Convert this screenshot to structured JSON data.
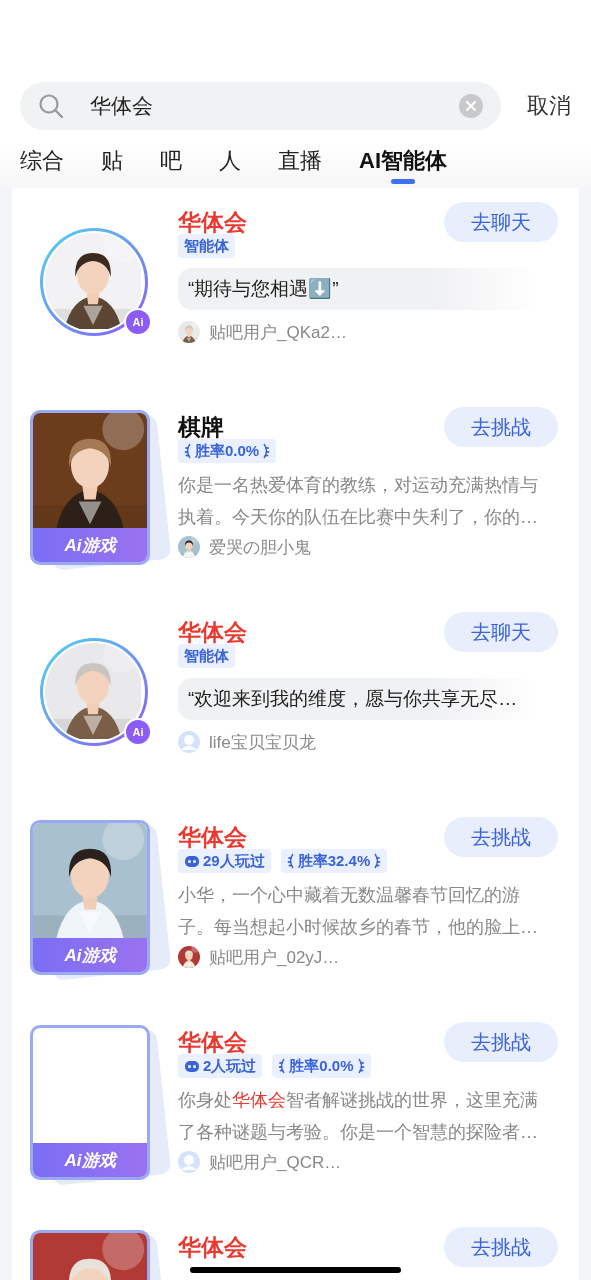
{
  "search": {
    "value": "华体会",
    "cancel": "取消"
  },
  "tabs": [
    {
      "label": "综合",
      "selected": false
    },
    {
      "label": "贴",
      "selected": false
    },
    {
      "label": "吧",
      "selected": false
    },
    {
      "label": "人",
      "selected": false
    },
    {
      "label": "直播",
      "selected": false
    },
    {
      "label": "AI智能体",
      "selected": true
    }
  ],
  "results": [
    {
      "kind": "agent",
      "title": "华体会",
      "highlighted": true,
      "button": "去聊天",
      "badge": "Ai",
      "tags": [
        {
          "kind": "type",
          "text": "智能体"
        }
      ],
      "quote": "“期待与您相遇⬇️”",
      "author": "贴吧用户_QKa2…",
      "author_avatar": {
        "kind": "picture"
      }
    },
    {
      "kind": "game",
      "title": "棋牌",
      "highlighted": false,
      "button": "去挑战",
      "banner": "Ai游戏",
      "picture": true,
      "tags": [
        {
          "kind": "winrate",
          "text": "胜率0.0%"
        }
      ],
      "description": [
        [
          {
            "text": "你是一名热爱体育的教练，对运动充满热情与",
            "highlighted": false
          }
        ],
        [
          {
            "text": "执着。今天你的队伍在比赛中失利了，你的…",
            "highlighted": false
          }
        ]
      ],
      "author": "爱哭の胆小鬼",
      "author_avatar": {
        "kind": "picture"
      }
    },
    {
      "kind": "agent",
      "title": "华体会",
      "highlighted": true,
      "button": "去聊天",
      "badge": "Ai",
      "tags": [
        {
          "kind": "type",
          "text": "智能体"
        }
      ],
      "quote": "“欢迎来到我的维度，愿与你共享无尽…",
      "author": "life宝贝宝贝龙",
      "author_avatar": {
        "kind": "default"
      }
    },
    {
      "kind": "game",
      "title": "华体会",
      "highlighted": true,
      "button": "去挑战",
      "banner": "Ai游戏",
      "picture": true,
      "tags": [
        {
          "kind": "plays",
          "text": "29人玩过"
        },
        {
          "kind": "winrate",
          "text": "胜率32.4%"
        }
      ],
      "description": [
        [
          {
            "text": "小华，一个心中藏着无数温馨春节回忆的游",
            "highlighted": false
          }
        ],
        [
          {
            "text": "子。每当想起小时候故乡的春节，他的脸上…",
            "highlighted": false
          }
        ]
      ],
      "author": "贴吧用户_02yJ…",
      "author_avatar": {
        "kind": "picture"
      }
    },
    {
      "kind": "game",
      "title": "华体会",
      "highlighted": true,
      "button": "去挑战",
      "banner": "Ai游戏",
      "picture": false,
      "tags": [
        {
          "kind": "plays",
          "text": "2人玩过"
        },
        {
          "kind": "winrate",
          "text": "胜率0.0%"
        }
      ],
      "description": [
        [
          {
            "text": "你身处",
            "highlighted": false
          },
          {
            "text": "华体会",
            "highlighted": true
          },
          {
            "text": "智者解谜挑战的世界，这里充满",
            "highlighted": false
          }
        ],
        [
          {
            "text": "了各种谜题与考验。你是一个智慧的探险者…",
            "highlighted": false
          }
        ]
      ],
      "author": "贴吧用户_QCR…",
      "author_avatar": {
        "kind": "default"
      }
    },
    {
      "kind": "game",
      "title": "华体会",
      "highlighted": true,
      "button": "去挑战",
      "picture": true
    }
  ]
}
